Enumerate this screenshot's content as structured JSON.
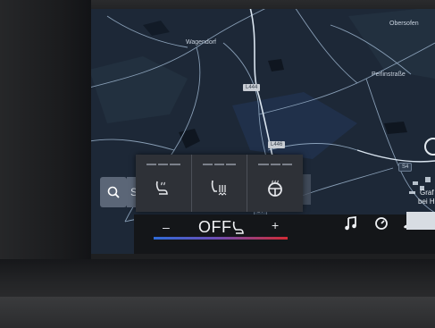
{
  "map": {
    "places": [
      "Wagendorf",
      "Obersofen",
      "Perlinstraße",
      "Graf",
      "bei He"
    ],
    "road_labels": [
      "L444",
      "L446",
      "S4"
    ],
    "route_badge": "54"
  },
  "search": {
    "value": "S"
  },
  "climate_panel": {
    "buttons": [
      {
        "name": "seat-heating",
        "level": 0
      },
      {
        "name": "seat-ventilation",
        "level": 0
      },
      {
        "name": "steering-wheel-heating",
        "level": 0
      }
    ],
    "level_max": 3
  },
  "climate_bar": {
    "minus_label": "–",
    "plus_label": "+",
    "fan_state": "OFF",
    "colors": {
      "cold": "#2f6bd8",
      "hot": "#d22b36"
    }
  },
  "media_shortcuts": {
    "icons": [
      "music-note-icon",
      "speedometer-icon",
      "fan-icon"
    ]
  }
}
